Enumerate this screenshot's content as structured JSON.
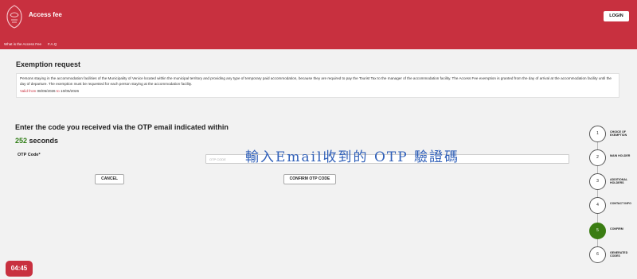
{
  "header": {
    "app_title": "Access fee",
    "login_label": "LOGIN",
    "nav": [
      "What is the Access Fee",
      "F.A.Q"
    ]
  },
  "info": {
    "title": "Exemption request",
    "text": "Persons staying in the accommodation facilities of the Municipality of Venice located within the municipal territory and providing any type of temporary paid accommodation, because they are required to pay the Tourist Tax to the manager of the accommodation facility. The Access Fee exemption is granted from the day of arrival at the accommodation facility until the day of departure. The exemption must be requested for each person staying at the accommodation facility.",
    "valid_from_label": "Valid from",
    "valid_from": "08/05/2026",
    "to_label": "to",
    "valid_to": "10/05/2026"
  },
  "otp": {
    "heading_before": "Enter the code you received via the OTP email indicated within",
    "seconds": "252",
    "heading_after": "seconds",
    "label": "OTP Code*",
    "placeholder": "OTP CODE",
    "overlay_text": "輸入Email收到的 OTP 驗證碼",
    "cancel_label": "CANCEL",
    "confirm_label": "CONFIRM OTP CODE"
  },
  "steps": [
    {
      "num": "1",
      "label": "CHOICE OF EXEMPTION"
    },
    {
      "num": "2",
      "label": "MAIN HOLDER"
    },
    {
      "num": "3",
      "label": "ADDITIONAL HOLDERS"
    },
    {
      "num": "4",
      "label": "CONTACT INFO"
    },
    {
      "num": "5",
      "label": "CONFIRM"
    },
    {
      "num": "6",
      "label": "GENERATED CODES"
    }
  ],
  "active_step": 5,
  "timer": "04:45",
  "colors": {
    "brand": "#c8303f",
    "active": "#3a7d12"
  }
}
